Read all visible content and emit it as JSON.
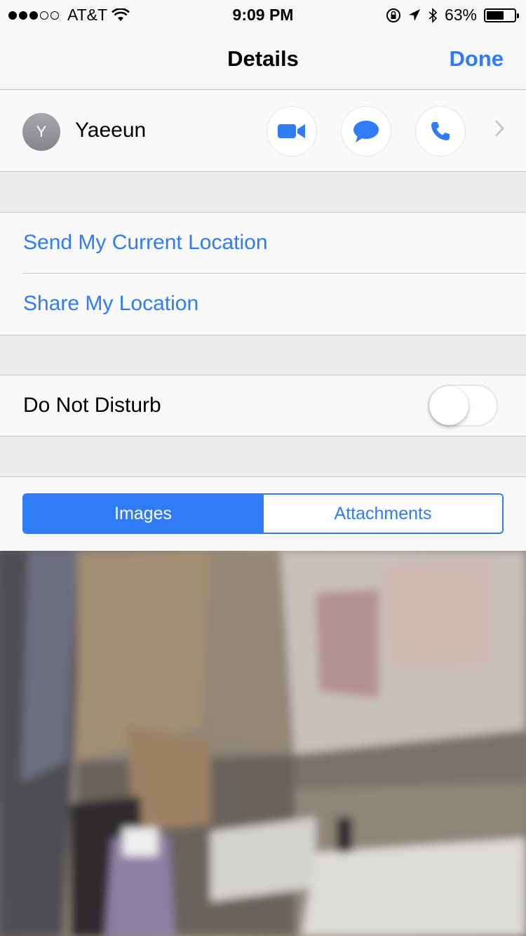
{
  "status_bar": {
    "carrier": "AT&T",
    "time": "9:09 PM",
    "battery_percent": "63%",
    "battery_level": 0.63,
    "signal_bars_filled": 3,
    "signal_bars_total": 5
  },
  "nav": {
    "title": "Details",
    "done_label": "Done"
  },
  "contact": {
    "initial": "Y",
    "name": "Yaeeun",
    "actions": [
      "video-call",
      "message",
      "phone-call"
    ]
  },
  "location": {
    "send_current": "Send My Current Location",
    "share": "Share My Location"
  },
  "dnd": {
    "label": "Do Not Disturb",
    "enabled": false
  },
  "segments": {
    "images_label": "Images",
    "attachments_label": "Attachments",
    "selected": "Images"
  },
  "colors": {
    "accent": "#2f7cf6",
    "background": "#ececee",
    "cell": "#f9f9f9"
  }
}
